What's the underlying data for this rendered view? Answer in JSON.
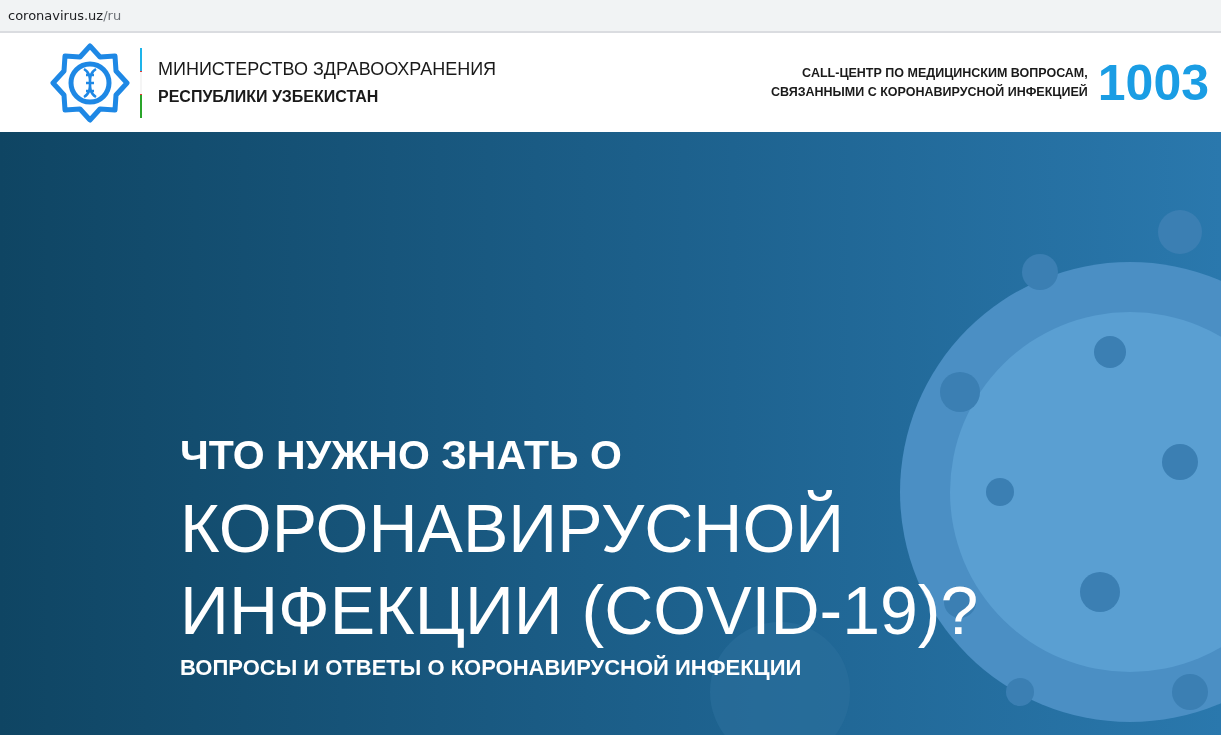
{
  "address_bar": {
    "host": "coronavirus.uz",
    "path": "/ru"
  },
  "header": {
    "ministry_line_1": "МИНИСТЕРСТВО ЗДРАВООХРАНЕНИЯ",
    "ministry_line_2": "РЕСПУБЛИКИ УЗБЕКИСТАН",
    "call_center_lines": [
      "CALL-ЦЕНТР ПО МЕДИЦИНСКИМ ВОПРОСАМ,",
      "СВЯЗАННЫМИ С КОРОНАВИРУСНОЙ ИНФЕКЦИЕЙ"
    ],
    "phone": "1003"
  },
  "hero": {
    "kind": "picture",
    "kicker": "ЧТО НУЖНО ЗНАТЬ О",
    "title_lines": [
      "КОРОНАВИРУСНОЙ",
      "ИНФЕКЦИИ (COVID-19)?"
    ],
    "subtitle": "ВОПРОСЫ И ОТВЕТЫ О КОРОНАВИРУСНОЙ ИНФЕКЦИИ"
  }
}
